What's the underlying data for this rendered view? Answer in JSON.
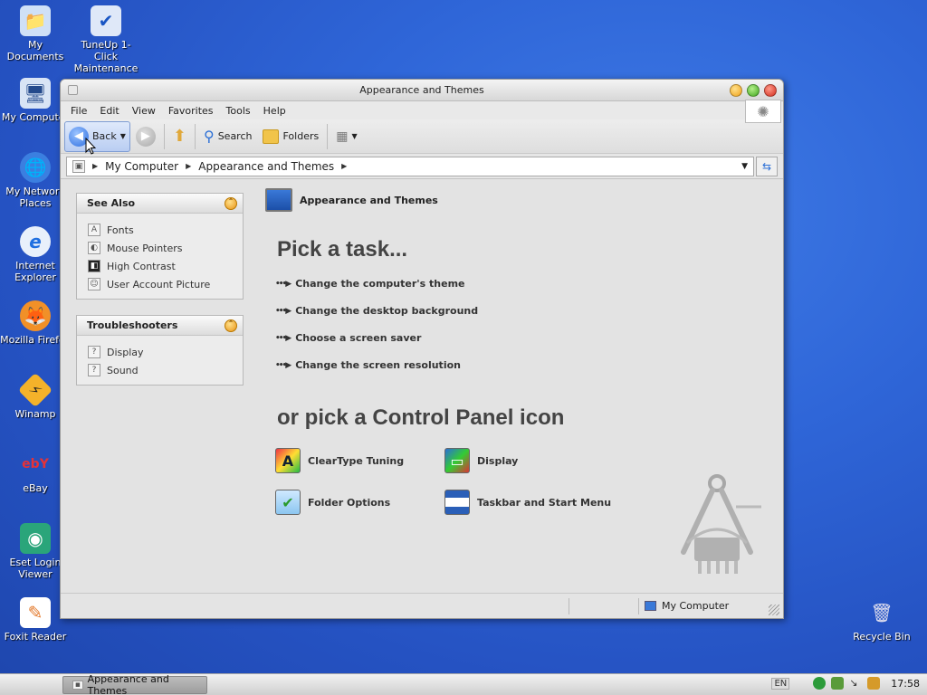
{
  "desktop": {
    "icons": [
      {
        "label": "My Documents",
        "glyph": "📁"
      },
      {
        "label": "TuneUp 1-Click Maintenance",
        "glyph": "✔"
      },
      {
        "label": "My Computer",
        "glyph": "🖥"
      },
      {
        "label": "My Network Places",
        "glyph": "🌐"
      },
      {
        "label": "Internet Explorer",
        "glyph": "e"
      },
      {
        "label": "Mozilla Firefox",
        "glyph": "🦊"
      },
      {
        "label": "Winamp",
        "glyph": "⚡"
      },
      {
        "label": "eBay",
        "glyph": "ebY"
      },
      {
        "label": "Eset Login Viewer",
        "glyph": "◉"
      },
      {
        "label": "Foxit Reader",
        "glyph": "✎"
      },
      {
        "label": "Recycle Bin",
        "glyph": "🗑"
      }
    ]
  },
  "window": {
    "title": "Appearance and Themes",
    "menu": [
      "File",
      "Edit",
      "View",
      "Favorites",
      "Tools",
      "Help"
    ],
    "toolbar": {
      "back_label": "Back",
      "search_label": "Search",
      "folders_label": "Folders"
    },
    "address": {
      "crumbs": [
        "My Computer",
        "Appearance and Themes"
      ]
    },
    "see_also": {
      "title": "See Also",
      "items": [
        "Fonts",
        "Mouse Pointers",
        "High Contrast",
        "User Account Picture"
      ]
    },
    "troubleshooters": {
      "title": "Troubleshooters",
      "items": [
        "Display",
        "Sound"
      ]
    },
    "main": {
      "heading": "Appearance and Themes",
      "pick_task": "Pick a task...",
      "tasks": [
        "Change the computer's theme",
        "Change the desktop background",
        "Choose a screen saver",
        "Change the screen resolution"
      ],
      "pick_icon": "or pick a Control Panel icon",
      "icons": [
        "ClearType Tuning",
        "Display",
        "Folder Options",
        "Taskbar and Start Menu"
      ]
    },
    "status": {
      "location": "My Computer"
    }
  },
  "taskbar": {
    "task": "Appearance and Themes",
    "lang": "EN",
    "clock": "17:58"
  },
  "colors": {
    "desktop": "#2f66d8",
    "accent": "#2d6ee0"
  }
}
